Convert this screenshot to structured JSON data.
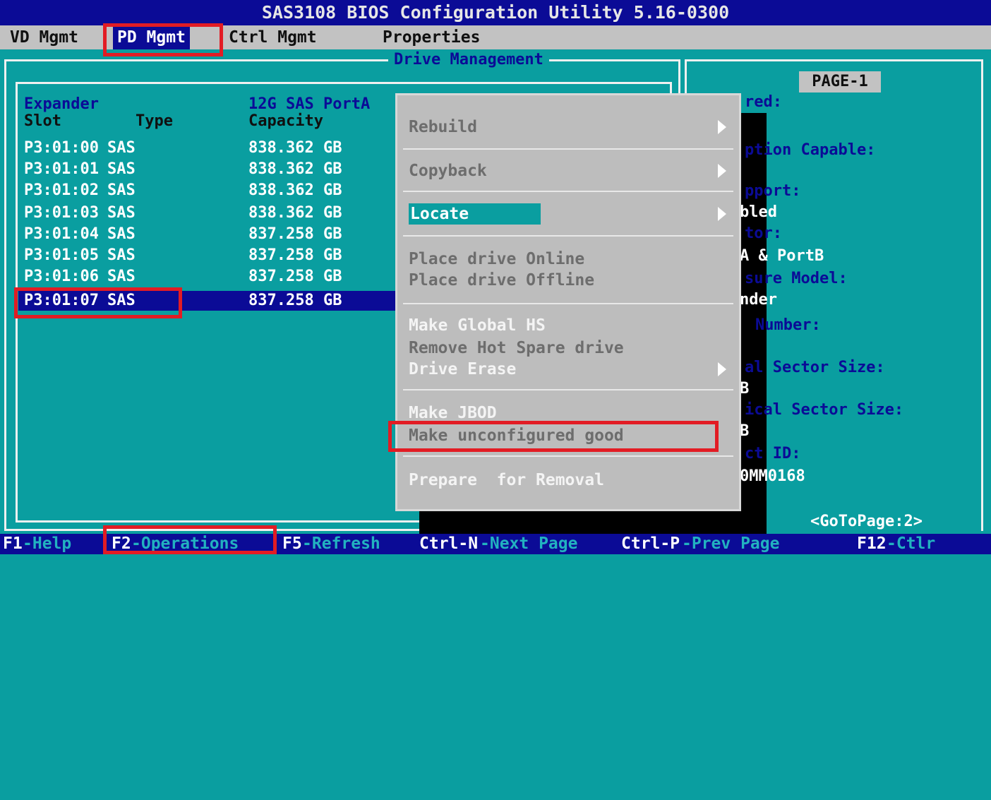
{
  "title": "SAS3108 BIOS Configuration Utility 5.16-0300",
  "menu": [
    "VD Mgmt",
    "PD Mgmt",
    "Ctrl Mgmt",
    "Properties"
  ],
  "active_menu": "PD Mgmt",
  "panel_title": "Drive Management",
  "drive_list": {
    "expander_label": "Expander",
    "port_label": "12G SAS PortA",
    "columns": [
      "Slot",
      "Type",
      "Capacity"
    ],
    "rows": [
      {
        "slot": "P3:01:00",
        "type": "SAS",
        "capacity": "838.362 GB"
      },
      {
        "slot": "P3:01:01",
        "type": "SAS",
        "capacity": "838.362 GB"
      },
      {
        "slot": "P3:01:02",
        "type": "SAS",
        "capacity": "838.362 GB"
      },
      {
        "slot": "P3:01:03",
        "type": "SAS",
        "capacity": "838.362 GB"
      },
      {
        "slot": "P3:01:04",
        "type": "SAS",
        "capacity": "837.258 GB"
      },
      {
        "slot": "P3:01:05",
        "type": "SAS",
        "capacity": "837.258 GB"
      },
      {
        "slot": "P3:01:06",
        "type": "SAS",
        "capacity": "837.258 GB"
      },
      {
        "slot": "P3:01:07",
        "type": "SAS",
        "capacity": "837.258 GB"
      }
    ],
    "selected_row": 7
  },
  "right_panel": {
    "page_label": "PAGE-1",
    "lines": [
      {
        "text": "red:",
        "style": "label"
      },
      {
        "text": "ption Capable:",
        "style": "label"
      },
      {
        "text": "pport:",
        "style": "label"
      },
      {
        "text": "bled",
        "style": "value"
      },
      {
        "text": "tor:",
        "style": "label"
      },
      {
        "text": "A & PortB",
        "style": "value"
      },
      {
        "text": "sure Model:",
        "style": "label"
      },
      {
        "text": "nder",
        "style": "value"
      },
      {
        "text": "Number:",
        "style": "label"
      },
      {
        "text": "al Sector Size:",
        "style": "label"
      },
      {
        "text": "B",
        "style": "value"
      },
      {
        "text": "ical Sector Size:",
        "style": "label"
      },
      {
        "text": "B",
        "style": "value"
      },
      {
        "text": "ct ID:",
        "style": "label"
      },
      {
        "text": "0MM0168",
        "style": "value"
      }
    ],
    "goto": "<GoToPage:2>"
  },
  "popup_menu": {
    "items": [
      {
        "label": "Rebuild",
        "enabled": false,
        "submenu": true
      },
      {
        "label": "Copyback",
        "enabled": false,
        "submenu": true
      },
      {
        "label": "Locate",
        "enabled": true,
        "submenu": true,
        "selected": true
      },
      {
        "label": "Place drive Online",
        "enabled": false
      },
      {
        "label": "Place drive Offline",
        "enabled": false
      },
      {
        "label": "Make Global HS",
        "enabled": true
      },
      {
        "label": "Remove Hot Spare drive",
        "enabled": false
      },
      {
        "label": "Drive Erase",
        "enabled": true,
        "submenu": true
      },
      {
        "label": "Make JBOD",
        "enabled": true
      },
      {
        "label": "Make unconfigured good",
        "enabled": false
      },
      {
        "label": "Prepare  for Removal",
        "enabled": true
      }
    ]
  },
  "status_bar": [
    {
      "key": "F1",
      "text": "-Help"
    },
    {
      "key": "F2",
      "text": "-Operations"
    },
    {
      "key": "F5",
      "text": "-Refresh"
    },
    {
      "key": "Ctrl-N",
      "text": "-Next Page"
    },
    {
      "key": "Ctrl-P",
      "text": "-Prev Page"
    },
    {
      "key": "F12",
      "text": "-Ctlr"
    }
  ],
  "colors": {
    "background": "#0a9ea0",
    "title_bar": "#0b0b96",
    "menu_bar": "#c2c2c2",
    "popup": "#bdbdbd",
    "highlight_box": "#e21c24"
  }
}
